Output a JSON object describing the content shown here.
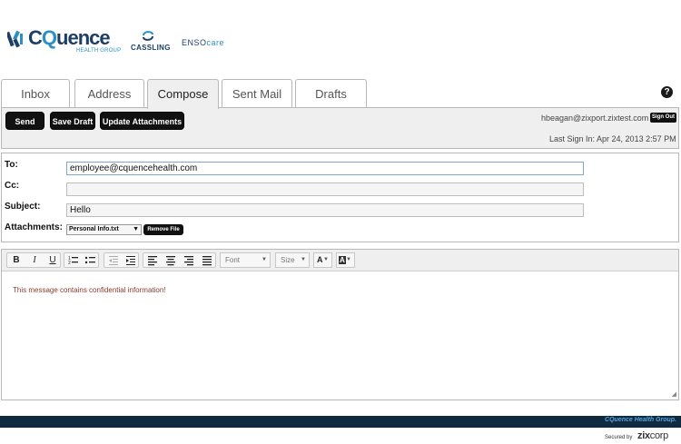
{
  "branding": {
    "cq_text_c": "C",
    "cq_text_q": "Q",
    "cq_text_rest": "uence",
    "cq_subtitle": "HEALTH GROUP",
    "cassling": "CASSLING",
    "enso_a": "ENSO",
    "enso_b": "care"
  },
  "tabs": [
    {
      "label": "Inbox"
    },
    {
      "label": "Address"
    },
    {
      "label": "Compose"
    },
    {
      "label": "Sent Mail"
    },
    {
      "label": "Drafts"
    }
  ],
  "help_label": "?",
  "toolbar": {
    "send_label": "Send",
    "save_draft_label": "Save Draft",
    "update_attachments_label": "Update Attachments",
    "user_email": "hbeagan@zixport.zixtest.com",
    "sign_out_label": "Sign Out",
    "last_sign_in": "Last Sign In: Apr 24, 2013 2:57 PM"
  },
  "fields": {
    "to_label": "To:",
    "to_value": "employee@cquencehealth.com",
    "cc_label": "Cc:",
    "cc_value": "",
    "subject_label": "Subject:",
    "subject_value": "Hello",
    "attachments_label": "Attachments:",
    "attachment_selected": "Personal Info.txt",
    "remove_file_label": "Remove File"
  },
  "editor": {
    "bold": "B",
    "italic": "I",
    "underline": "U",
    "font_label": "Font",
    "size_label": "Size",
    "text_color_label": "A",
    "bg_color_label": "A",
    "body_text": "This message contains confidential information!"
  },
  "footer": {
    "company": "CQuence Health Group.",
    "secured_by": "Secured by",
    "zix": "zix",
    "corp": "corp"
  },
  "colors": {
    "brand_dark": "#1d3f66",
    "brand_light": "#2a8fc4",
    "footer_bar": "#0f2a3f",
    "button_black": "#111111"
  }
}
